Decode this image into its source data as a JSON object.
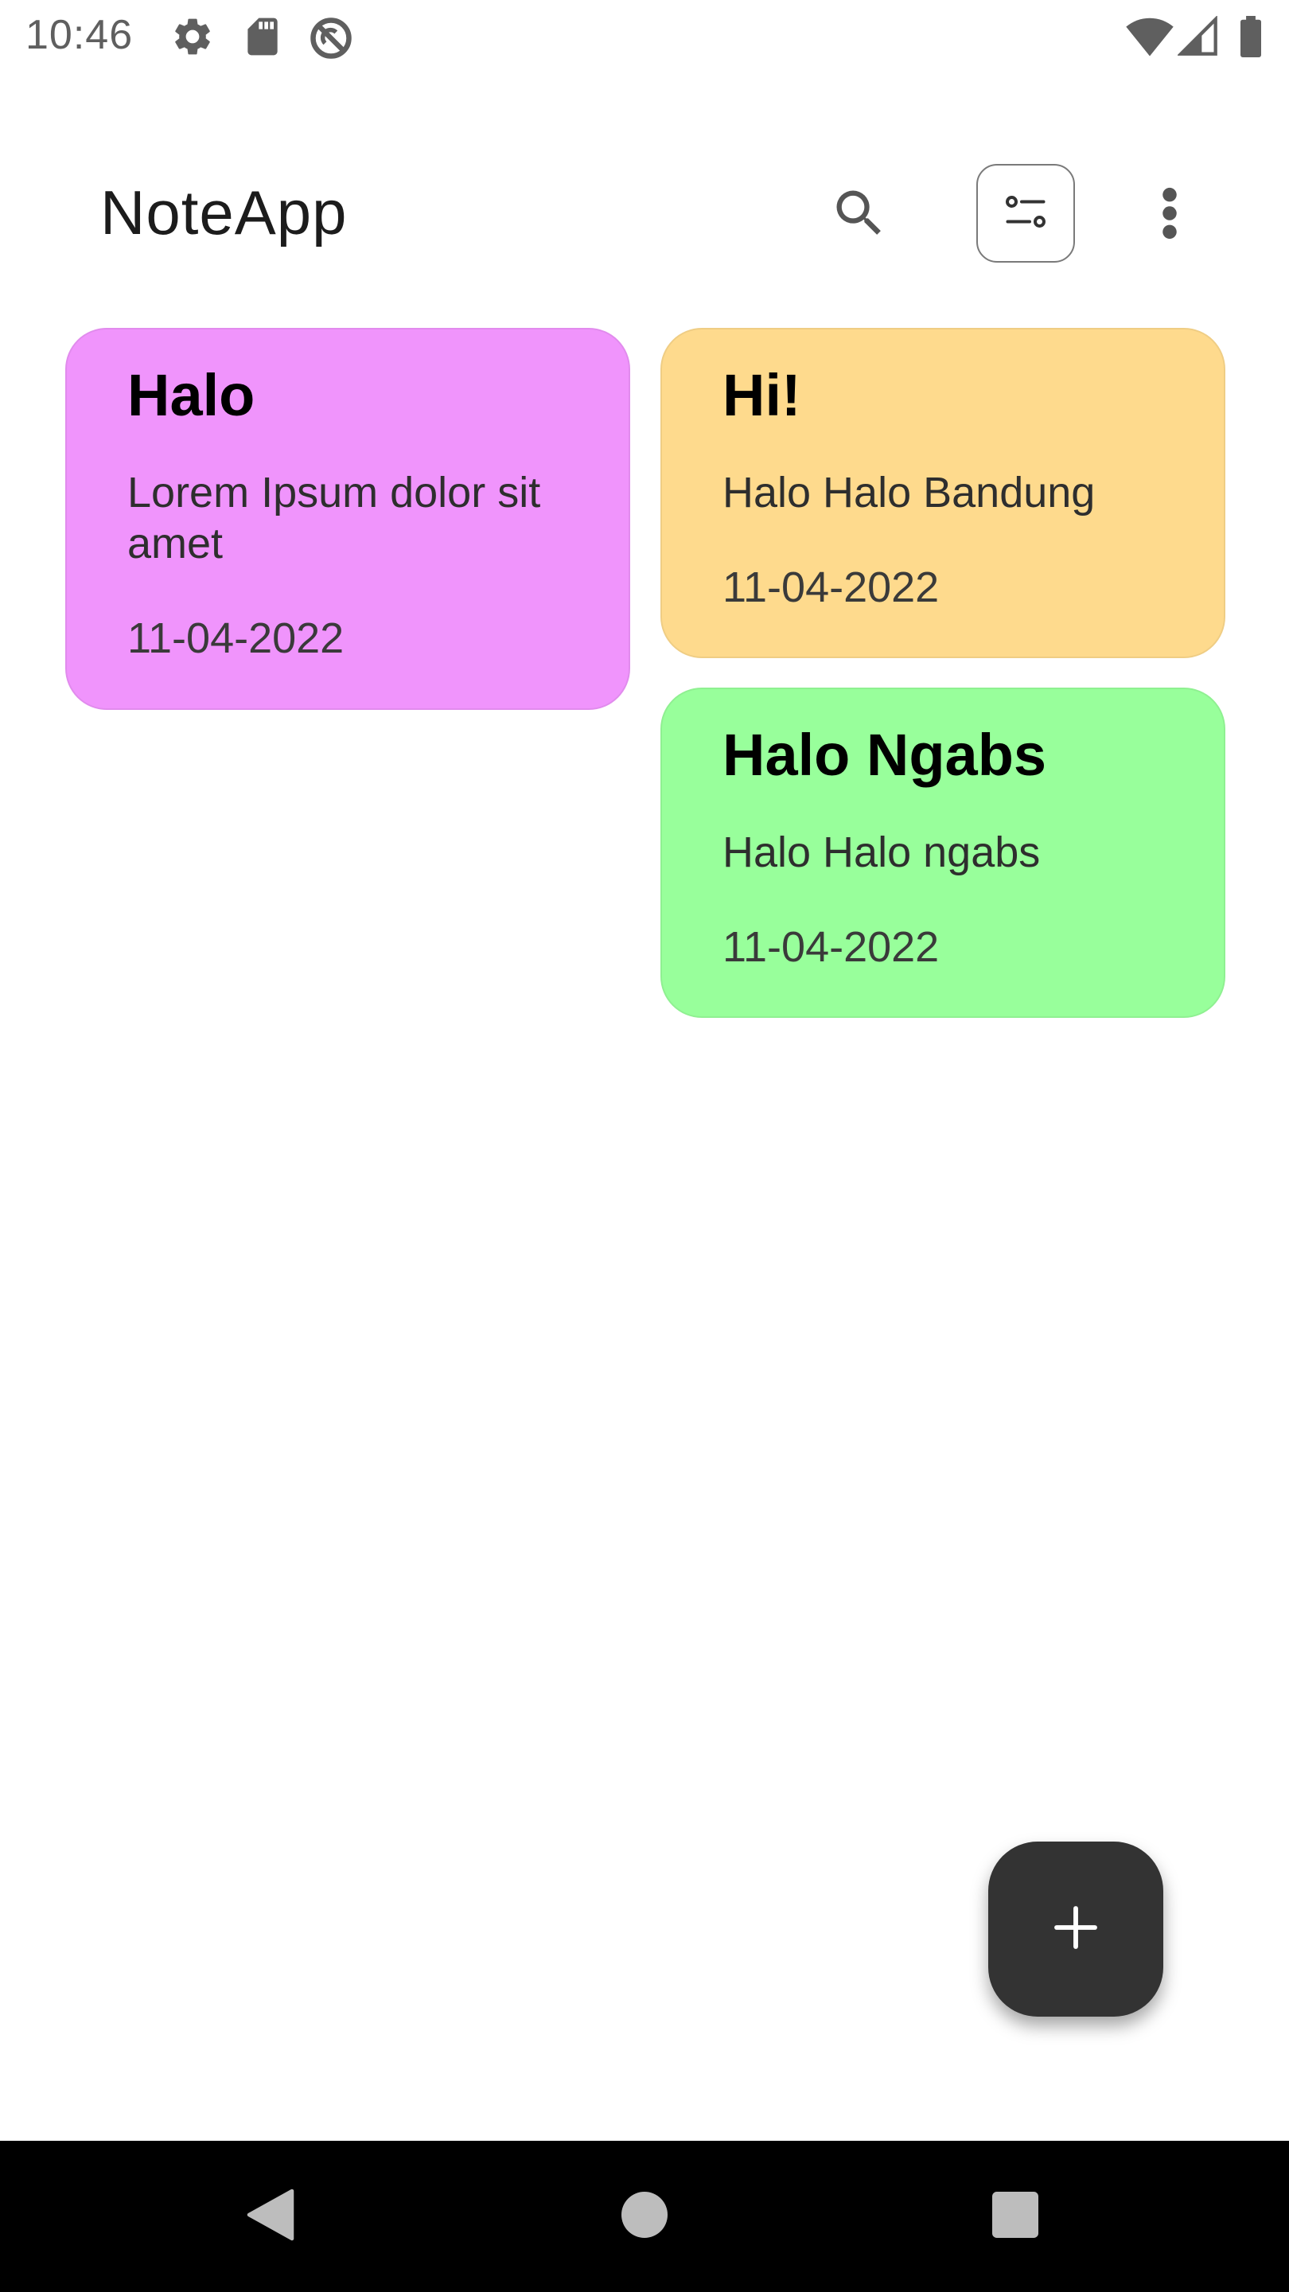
{
  "status_bar": {
    "time": "10:46",
    "left_icons": [
      "settings-icon",
      "sd-card-icon",
      "do-not-disturb-icon"
    ],
    "right_icons": [
      "wifi-icon",
      "signal-icon",
      "battery-icon"
    ]
  },
  "app_bar": {
    "title": "NoteApp",
    "icons": [
      "search-icon",
      "sort-icon",
      "more-vert-icon"
    ]
  },
  "notes": [
    {
      "title": "Halo",
      "body": "Lorem Ipsum dolor sit amet",
      "date": "11-04-2022",
      "color": "#F094FC"
    },
    {
      "title": "Hi!",
      "body": "Halo Halo Bandung",
      "date": "11-04-2022",
      "color": "#FEDA8D"
    },
    {
      "title": "Halo Ngabs",
      "body": "Halo Halo ngabs",
      "date": "11-04-2022",
      "color": "#98FF9B"
    }
  ],
  "fab": {
    "icon": "plus-icon",
    "color": "#333333"
  },
  "nav_bar": {
    "icons": [
      "back-icon",
      "home-icon",
      "recents-icon"
    ]
  }
}
